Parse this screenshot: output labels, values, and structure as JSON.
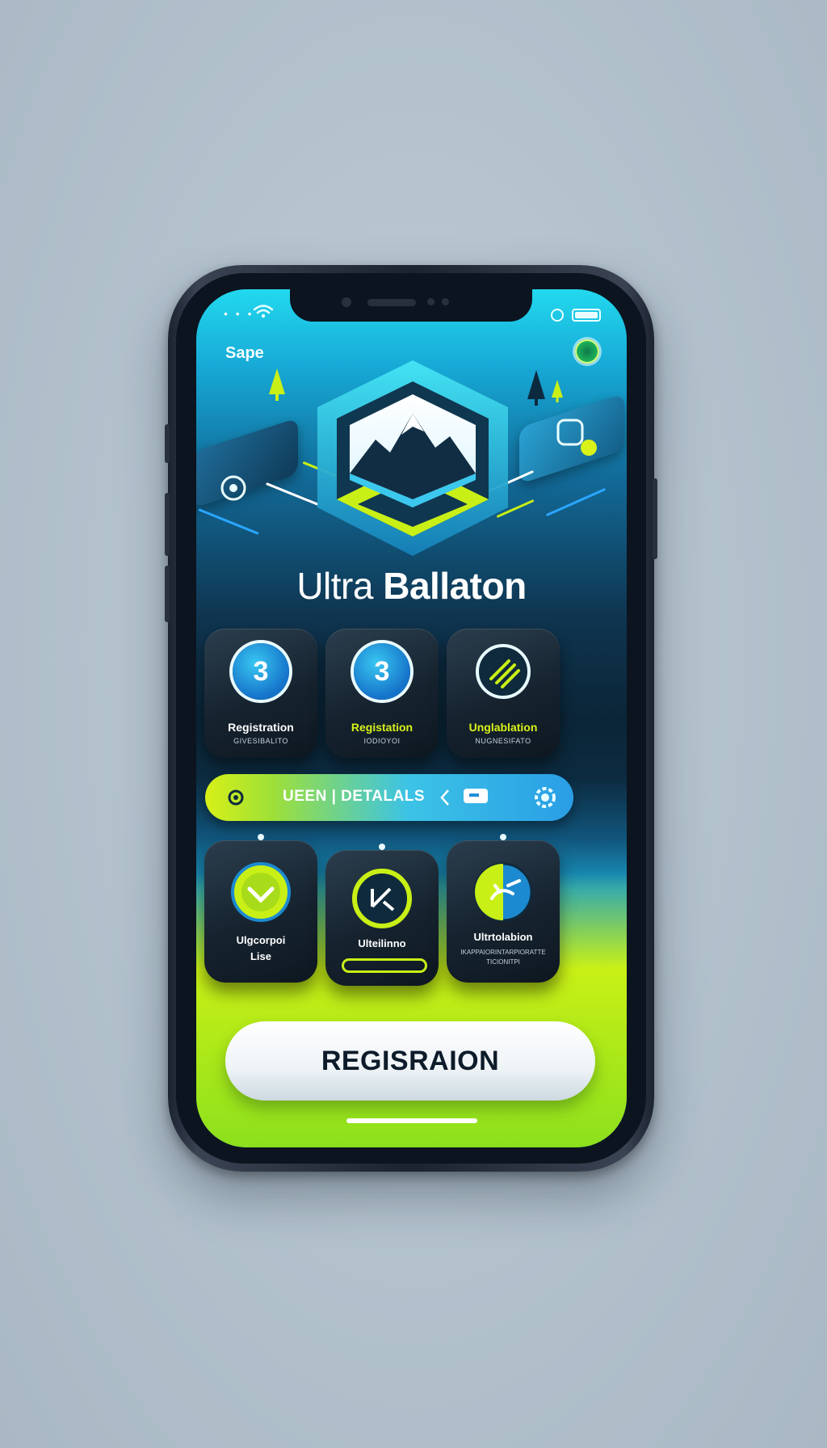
{
  "status_bar": {
    "signal": "• • •"
  },
  "header": {
    "brand_label": "Sape"
  },
  "app": {
    "title_light": "Ultra ",
    "title_bold": "Ballaton"
  },
  "top_cards": [
    {
      "badge": "3",
      "label": "Registration",
      "sub": "GIVESIBALITO"
    },
    {
      "badge": "3",
      "label": "Registation",
      "sub": "IODIOYOI"
    },
    {
      "badge": "",
      "label": "Unglablation",
      "sub": "NUGNESIFATO"
    }
  ],
  "details_bar": {
    "text": "UEEN | DETALALS"
  },
  "bottom_cards": [
    {
      "label_line1": "Ulgcorpoi",
      "label_line2": "Lise"
    },
    {
      "label_line1": "Ulteilinno"
    },
    {
      "label_line1": "Ultrtolabion",
      "label_line2": "IKAPPAIORINTARPIORATTE",
      "label_line3": "TICIONITPI"
    }
  ],
  "primary_button": {
    "label": "REGISRAION"
  },
  "colors": {
    "accent_lime": "#c9f016",
    "accent_cyan": "#22d9ee",
    "card_dark": "#16232f",
    "button_text": "#0d1b2a"
  },
  "icons": [
    "wifi-icon",
    "battery-icon",
    "mountain-logo-icon",
    "check-down-icon",
    "slash-icon",
    "runner-icon",
    "settings-icon",
    "chevron-left-icon",
    "chat-icon"
  ]
}
